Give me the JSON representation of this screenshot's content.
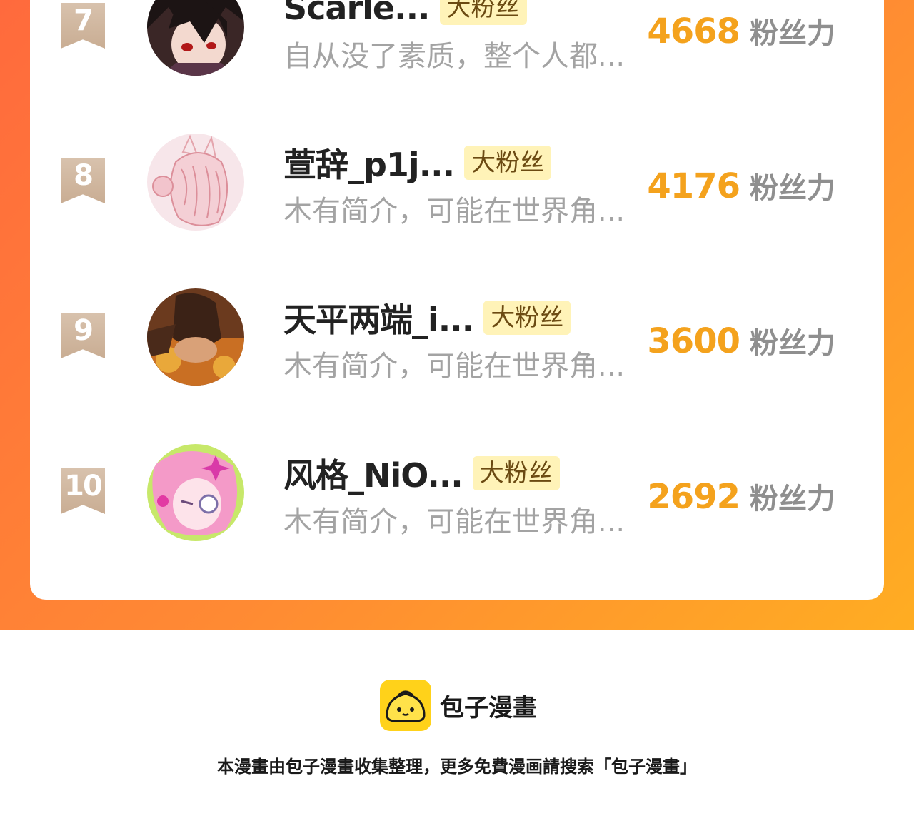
{
  "ranking": {
    "entries": [
      {
        "rank": "7",
        "name": "Scarle...",
        "badge": "大粉丝",
        "bio": "自从没了素质，整个人都...",
        "score": "4668",
        "unit": "粉丝力"
      },
      {
        "rank": "8",
        "name": "萱辞_p1j...",
        "badge": "大粉丝",
        "bio": "木有简介，可能在世界角...",
        "score": "4176",
        "unit": "粉丝力"
      },
      {
        "rank": "9",
        "name": "天平两端_i...",
        "badge": "大粉丝",
        "bio": "木有简介，可能在世界角...",
        "score": "3600",
        "unit": "粉丝力"
      },
      {
        "rank": "10",
        "name": "风格_NiO...",
        "badge": "大粉丝",
        "bio": "木有简介，可能在世界角...",
        "score": "2692",
        "unit": "粉丝力"
      }
    ]
  },
  "footer": {
    "brand": "包子漫畫",
    "note": "本漫畫由包子漫畫收集整理，更多免費漫画請搜索「包子漫畫」"
  },
  "colors": {
    "accent": "#f4a21d",
    "frame_start": "#ff6a3d",
    "frame_end": "#ffad22",
    "badge_bg": "#fff3b8",
    "rank_ribbon": "#cdb29a"
  },
  "icons": {
    "logo": "baozi-bun-icon"
  }
}
